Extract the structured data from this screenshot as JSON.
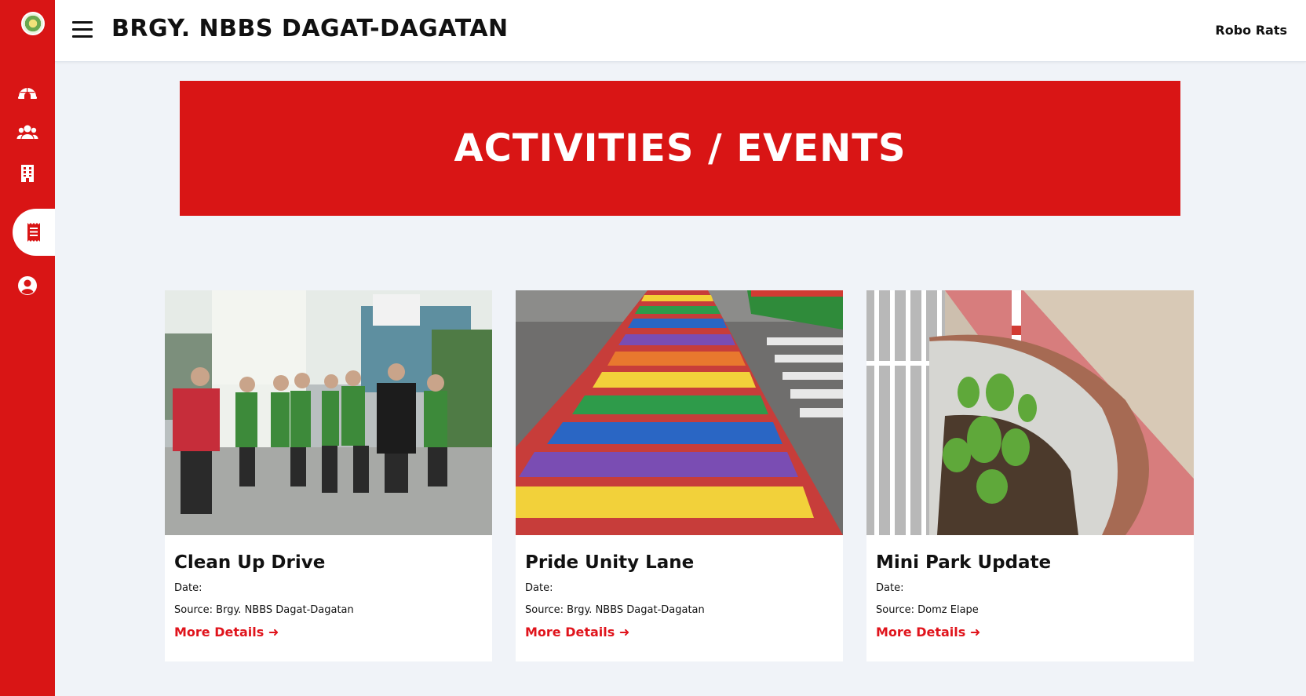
{
  "header": {
    "title": "BRGY. NBBS DAGAT-DAGATAN",
    "user": "Robo Rats"
  },
  "sidebar": {
    "items": [
      {
        "icon": "dashboard-igloo-icon"
      },
      {
        "icon": "users-icon"
      },
      {
        "icon": "building-icon"
      },
      {
        "icon": "receipt-icon",
        "active": true
      },
      {
        "icon": "user-circle-icon"
      }
    ]
  },
  "banner": {
    "title": "ACTIVITIES / EVENTS"
  },
  "events": [
    {
      "title": "Clean Up Drive",
      "date_label": "Date:",
      "date_value": "",
      "source_label": "Source:",
      "source_value": "Brgy. NBBS Dagat-Dagatan",
      "link": "More Details ➜"
    },
    {
      "title": "Pride Unity Lane",
      "date_label": "Date:",
      "date_value": "",
      "source_label": "Source:",
      "source_value": "Brgy. NBBS Dagat-Dagatan",
      "link": "More Details ➜"
    },
    {
      "title": "Mini Park Update",
      "date_label": "Date:",
      "date_value": "",
      "source_label": "Source:",
      "source_value": "Domz Elape",
      "link": "More Details ➜"
    }
  ],
  "colors": {
    "brand_red": "#d91515",
    "link_red": "#e0141c",
    "page_bg": "#f0f3f8"
  }
}
